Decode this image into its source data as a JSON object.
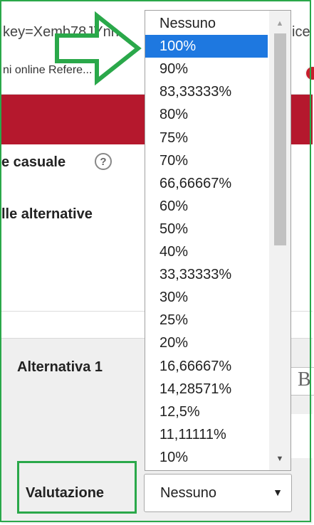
{
  "browser": {
    "url_left": "key=Xemb78JYnn",
    "url_right": "ice",
    "bookmark_text": "ni online Refere..."
  },
  "form": {
    "random_label": "e casuale",
    "alternatives_label": "lle alternative",
    "help_icon": "?"
  },
  "alternative": {
    "label": "Alternativa 1",
    "editor_glyph": "B"
  },
  "valutazione": {
    "label": "Valutazione",
    "selected": "Nessuno",
    "arrow": "▼"
  },
  "dropdown": {
    "options": [
      "Nessuno",
      "100%",
      "90%",
      "83,33333%",
      "80%",
      "75%",
      "70%",
      "66,66667%",
      "60%",
      "50%",
      "40%",
      "33,33333%",
      "30%",
      "25%",
      "20%",
      "16,66667%",
      "14,28571%",
      "12,5%",
      "11,11111%",
      "10%"
    ],
    "highlighted_index": 1,
    "scroll_up": "▲",
    "scroll_down": "▼"
  },
  "colors": {
    "header": "#b5182d",
    "highlight": "#1e78e0",
    "annotation": "#2aa84a"
  },
  "icons": [
    "help-icon",
    "green-annotation-arrow-icon",
    "dropdown-arrow-icon",
    "bookmark-favicon-icon"
  ]
}
